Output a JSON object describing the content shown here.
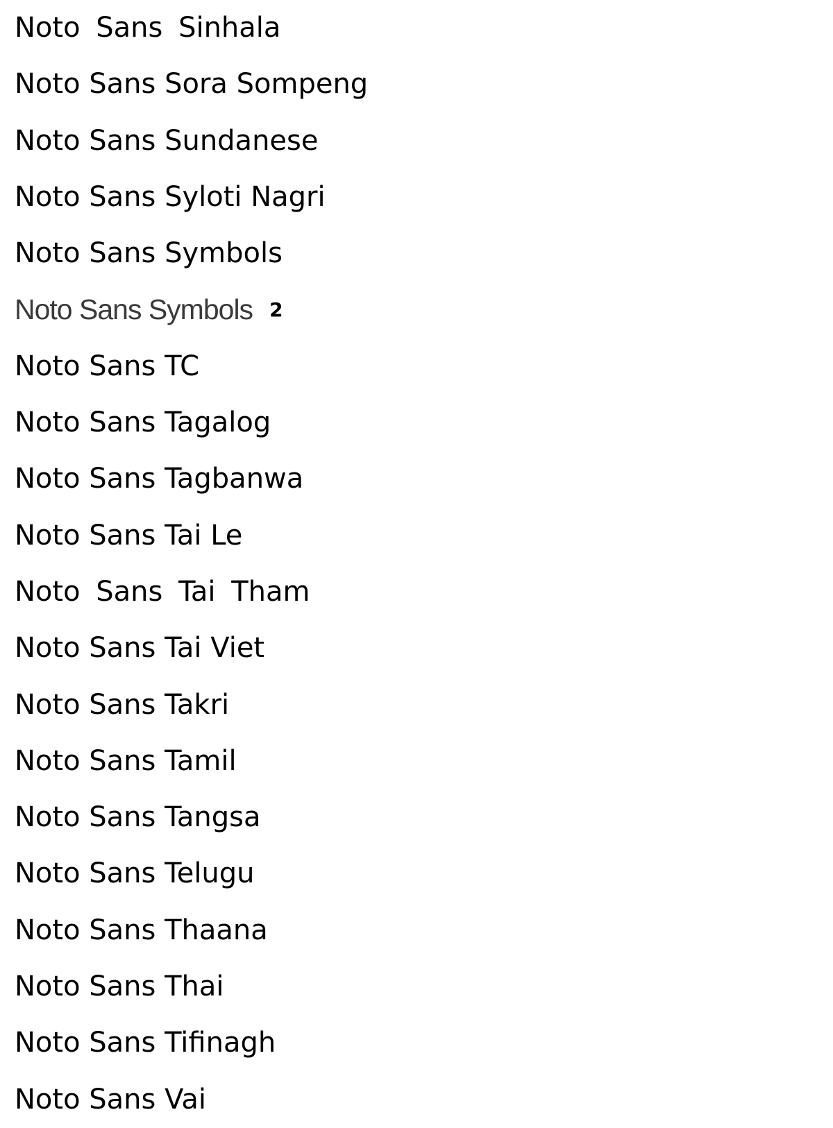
{
  "fonts": [
    {
      "name": "Noto Sans Sinhala"
    },
    {
      "name": "Noto Sans Sora Sompeng"
    },
    {
      "name": "Noto Sans Sundanese"
    },
    {
      "name": "Noto Sans Syloti Nagri"
    },
    {
      "name": "Noto Sans Symbols"
    },
    {
      "name": "Noto Sans Symbols",
      "suffix": "2"
    },
    {
      "name": "Noto Sans TC"
    },
    {
      "name": "Noto Sans Tagalog"
    },
    {
      "name": "Noto Sans Tagbanwa"
    },
    {
      "name": "Noto Sans Tai Le"
    },
    {
      "name": "Noto Sans Tai Tham"
    },
    {
      "name": "Noto Sans Tai Viet"
    },
    {
      "name": "Noto Sans Takri"
    },
    {
      "name": "Noto Sans Tamil"
    },
    {
      "name": "Noto Sans Tangsa"
    },
    {
      "name": "Noto Sans Telugu"
    },
    {
      "name": "Noto Sans Thaana"
    },
    {
      "name": "Noto Sans Thai"
    },
    {
      "name": "Noto Sans Tifinagh"
    },
    {
      "name": "Noto Sans Vai"
    }
  ]
}
